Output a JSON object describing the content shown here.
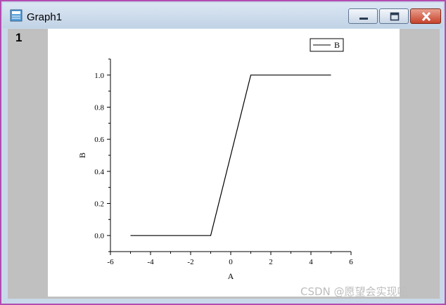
{
  "window": {
    "title": "Graph1",
    "layer_label": "1",
    "icon": "graph-window-icon",
    "controls": [
      "minimize-icon",
      "maximize-icon",
      "close-icon"
    ]
  },
  "watermark": "CSDN @愿望会实现吧",
  "chart_data": {
    "type": "line",
    "title": "",
    "xlabel": "A",
    "ylabel": "B",
    "xlim": [
      -6,
      6
    ],
    "ylim": [
      -0.1,
      1.1
    ],
    "x_ticks": [
      -6,
      -4,
      -2,
      0,
      2,
      4,
      6
    ],
    "x_tick_labels": [
      "-6",
      "-4",
      "-2",
      "0",
      "2",
      "4",
      "6"
    ],
    "y_ticks": [
      0,
      0.2,
      0.4,
      0.6,
      0.8,
      1.0
    ],
    "y_tick_labels": [
      "0.0",
      "0.2",
      "0.4",
      "0.6",
      "0.8",
      "1.0"
    ],
    "grid": false,
    "legend_position": "top-right",
    "series": [
      {
        "name": "B",
        "color": "#000000",
        "x": [
          -5,
          -1,
          1,
          5
        ],
        "y": [
          0,
          0,
          1,
          1
        ]
      }
    ]
  }
}
